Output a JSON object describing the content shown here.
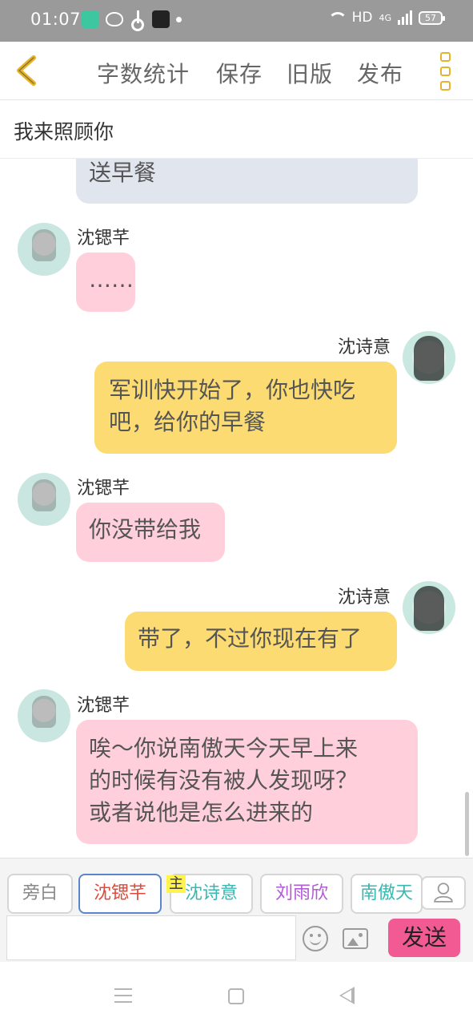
{
  "status_bar": {
    "time": "01:07",
    "network": "HD",
    "cellular": "4G",
    "battery": "57"
  },
  "toolbar": {
    "word_count": "字数统计",
    "save": "保存",
    "old_version": "旧版",
    "publish": "发布"
  },
  "title": "我来照顾你",
  "colors": {
    "accent": "#e6b42a",
    "narration_bubble": "#e1e6ee",
    "pink_bubble": "#ffd0dc",
    "yellow_bubble": "#fcdc72",
    "send_button": "#f25a93"
  },
  "messages": [
    {
      "type": "narration",
      "text": "送早餐"
    },
    {
      "speaker": "沈锶芊",
      "side": "left",
      "text": "……"
    },
    {
      "speaker": "沈诗意",
      "side": "right",
      "text_lines": [
        "军训快开始了，你也快吃",
        "吧，给你的早餐"
      ]
    },
    {
      "speaker": "沈锶芊",
      "side": "left",
      "text": "你没带给我"
    },
    {
      "speaker": "沈诗意",
      "side": "right",
      "text": "带了，不过你现在有了"
    },
    {
      "speaker": "沈锶芊",
      "side": "left",
      "text_lines": [
        "唉～你说南傲天今天早上来",
        "的时候有没有被人发现呀？",
        "或者说他是怎么进来的"
      ]
    }
  ],
  "characters": [
    {
      "label": "旁白",
      "color": "#888888"
    },
    {
      "label": "沈锶芊",
      "color": "#e04a3a",
      "selected": true
    },
    {
      "label": "沈诗意",
      "color": "#3ab8b0"
    },
    {
      "label": "刘雨欣",
      "color": "#b35ad6"
    },
    {
      "label": "南傲天",
      "color": "#3ab8b0"
    }
  ],
  "main_badge": "主",
  "input": {
    "placeholder": ""
  },
  "send_label": "发送"
}
